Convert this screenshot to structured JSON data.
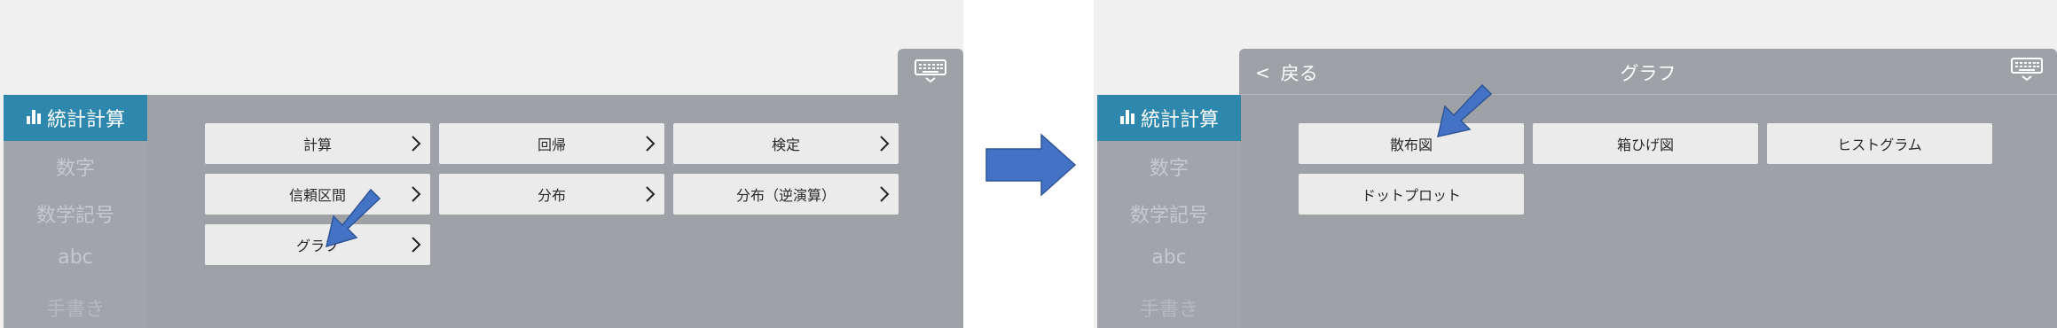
{
  "left": {
    "sidebar": {
      "active_label": "統計計算",
      "items": [
        "数字",
        "数学記号",
        "abc",
        "手書き"
      ]
    },
    "buttons": [
      "計算",
      "回帰",
      "検定",
      "信頼区間",
      "分布",
      "分布（逆演算）",
      "グラフ"
    ]
  },
  "right": {
    "header": {
      "back_label": "戻る",
      "title": "グラフ"
    },
    "sidebar": {
      "active_label": "統計計算",
      "items": [
        "数字",
        "数学記号",
        "abc",
        "手書き"
      ]
    },
    "buttons": [
      "散布図",
      "箱ひげ図",
      "ヒストグラム",
      "ドットプロット"
    ]
  },
  "colors": {
    "panel_gray": "#9ea1a6",
    "active_blue": "#2e88ad",
    "button_bg": "#ebebeb",
    "arrow_blue": "#4472c4"
  },
  "icons": [
    "keyboard-icon",
    "bar-chart-icon",
    "chevron-right-icon",
    "back-chevron-icon",
    "pointer-arrow",
    "transition-arrow"
  ]
}
